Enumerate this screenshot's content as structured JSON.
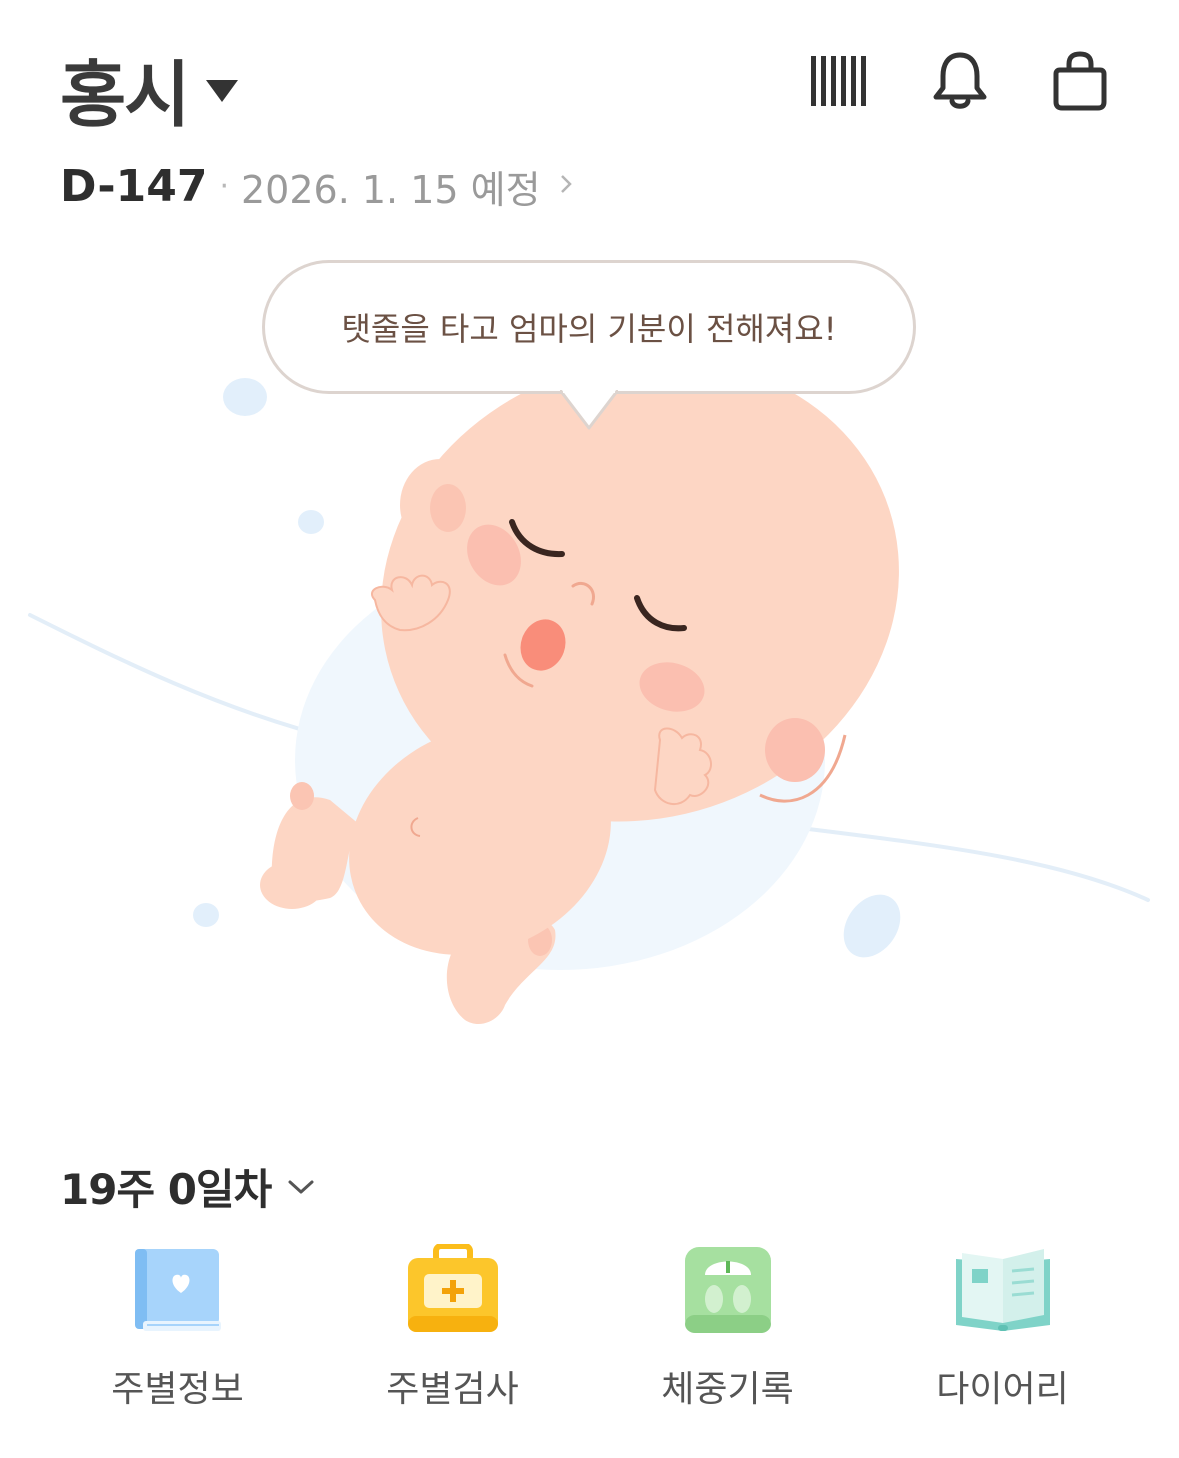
{
  "header": {
    "name": "홍시",
    "icons": [
      "barcode-icon",
      "bell-icon",
      "shopping-bag-icon"
    ]
  },
  "dday": {
    "count": "D-147",
    "separator": "·",
    "due_date": "2026. 1. 15 예정"
  },
  "hero": {
    "message": "탯줄을 타고 엄마의 기분이 전해져요!",
    "illustration": "sleeping-baby-illustration"
  },
  "week": {
    "label": "19주 0일차"
  },
  "menu": {
    "items": [
      {
        "label": "주별정보",
        "icon": "book-heart-icon"
      },
      {
        "label": "주별검사",
        "icon": "medical-kit-icon"
      },
      {
        "label": "체중기록",
        "icon": "scale-icon"
      },
      {
        "label": "다이어리",
        "icon": "diary-icon"
      }
    ]
  },
  "colors": {
    "text_dark": "#2e2e2e",
    "text_gray": "#9a9a9a",
    "bubble_border": "#ddd4cf",
    "bubble_text": "#6b5144",
    "skin": "#fdd6c4"
  }
}
